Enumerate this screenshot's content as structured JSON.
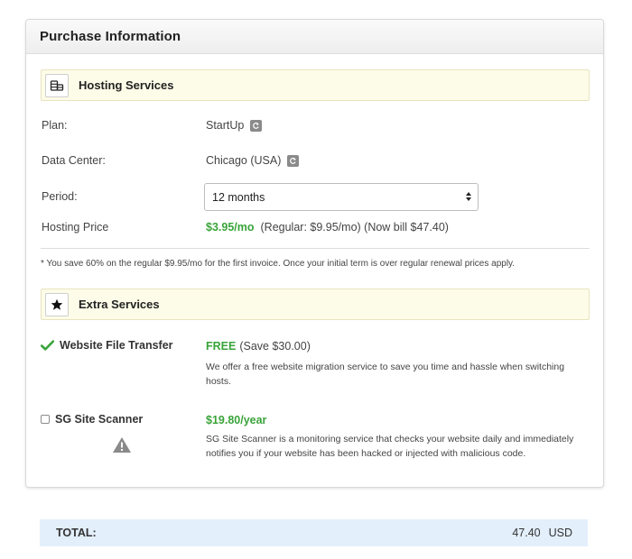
{
  "panel": {
    "title": "Purchase Information"
  },
  "hosting": {
    "section_title": "Hosting Services",
    "section_icon": "coins-icon",
    "plan_label": "Plan:",
    "plan_value": "StartUp",
    "datacenter_label": "Data Center:",
    "datacenter_value": "Chicago (USA)",
    "period_label": "Period:",
    "period_value": "12 months",
    "price_label": "Hosting Price",
    "price_value": "$3.95/mo",
    "price_detail": "(Regular: $9.95/mo) (Now bill $47.40)",
    "footnote": "* You save 60% on the regular $9.95/mo for the first invoice. Once your initial term is over regular renewal prices apply."
  },
  "extras": {
    "section_title": "Extra Services",
    "section_icon": "star-icon",
    "transfer": {
      "name": "Website File Transfer",
      "price": "FREE",
      "price_note": "(Save $30.00)",
      "description": "We offer a free website migration service to save you time and hassle when switching hosts.",
      "selected": true
    },
    "scanner": {
      "name": "SG Site Scanner",
      "price": "$19.80/year",
      "description": "SG Site Scanner is a monitoring service that checks your website daily and immediately notifies you if your website has been hacked or injected with malicious code.",
      "selected": false
    }
  },
  "total": {
    "label": "TOTAL:",
    "amount": "47.40",
    "currency": "USD"
  },
  "colors": {
    "accent_green": "#3aa43a",
    "section_bg": "#fdfce8",
    "total_bg": "#e3effb"
  }
}
